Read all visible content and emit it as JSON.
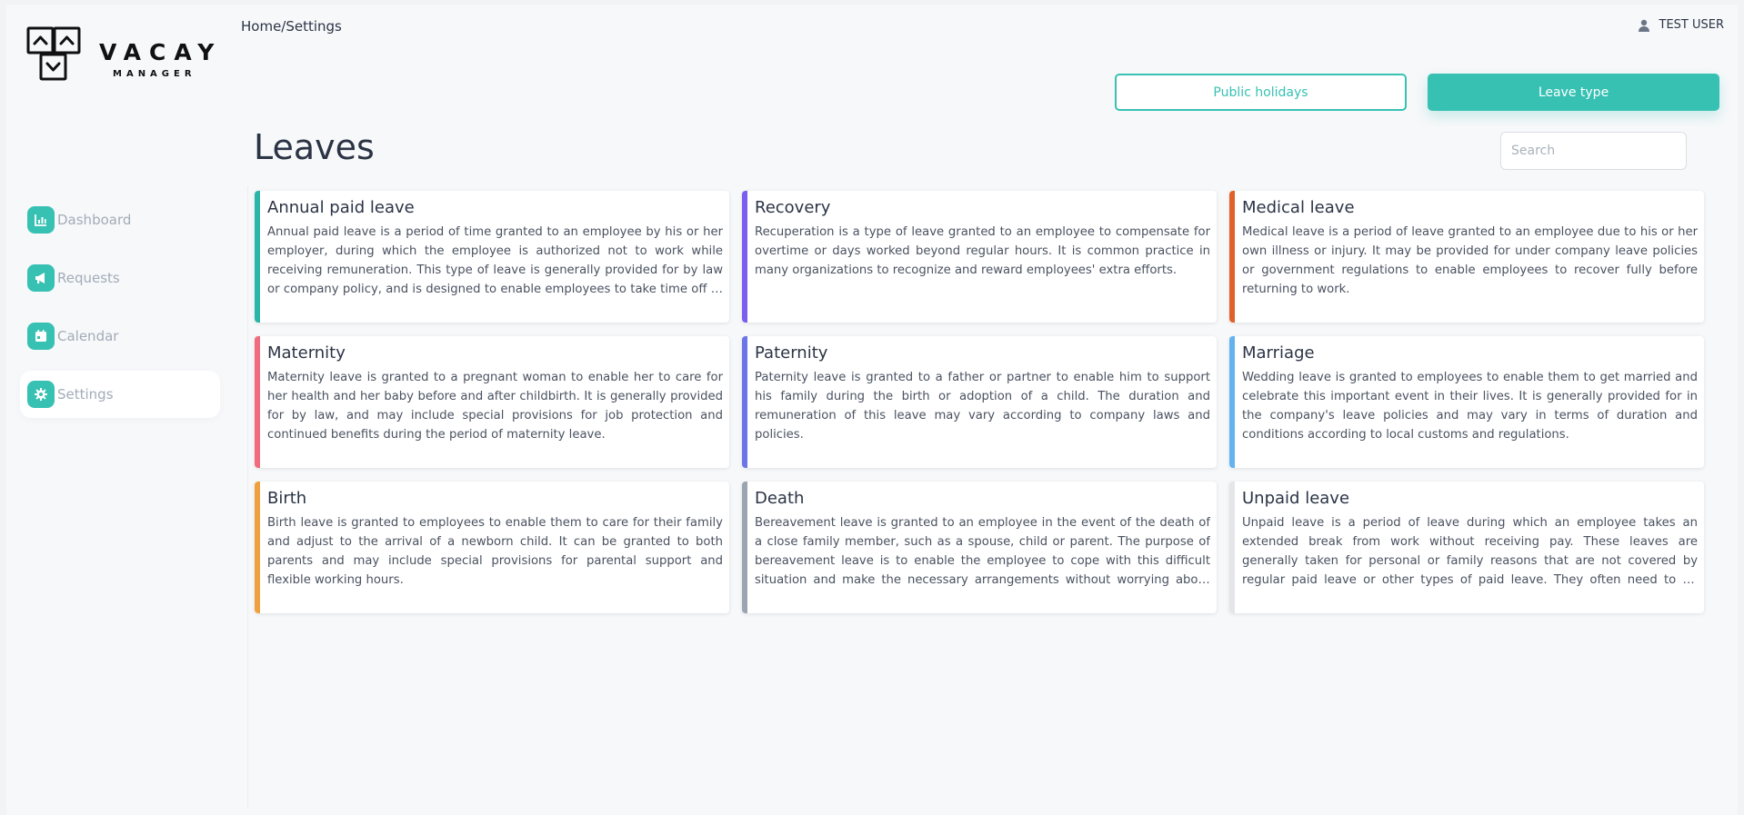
{
  "app": {
    "logo_word": "VACAY",
    "logo_sub": "MANAGER",
    "accent_color": "#37c1b3"
  },
  "header": {
    "breadcrumb": "Home/Settings",
    "user_name": "TEST USER",
    "user_icon": "user-icon"
  },
  "sidebar": {
    "items": [
      {
        "label": "Dashboard",
        "icon": "chart-icon",
        "active": false
      },
      {
        "label": "Requests",
        "icon": "megaphone-icon",
        "active": false
      },
      {
        "label": "Calendar",
        "icon": "calendar-icon",
        "active": false
      },
      {
        "label": "Settings",
        "icon": "gear-icon",
        "active": true
      }
    ]
  },
  "actions": {
    "public_holidays_label": "Public holidays",
    "leave_type_label": "Leave type"
  },
  "main": {
    "title": "Leaves",
    "search_placeholder": "Search"
  },
  "leaves": [
    {
      "title": "Annual paid leave",
      "color": "#2bb5a8",
      "description": "Annual paid leave is a period of time granted to an employee by his or her employer, during which the employee is authorized not to work while receiving remuneration. This type of leave is generally provided for by law or company policy, and is designed to enable employees to take time off to rest and recharge."
    },
    {
      "title": "Recovery",
      "color": "#7b5ef0",
      "description": "Recuperation is a type of leave granted to an employee to compensate for overtime or days worked beyond regular hours. It is common practice in many organizations to recognize and reward employees' extra efforts."
    },
    {
      "title": "Medical leave",
      "color": "#e0622a",
      "description": "Medical leave is a period of leave granted to an employee due to his or her own illness or injury. It may be provided for under company leave policies or government regulations to enable employees to recover fully before returning to work."
    },
    {
      "title": "Maternity",
      "color": "#ef6b7d",
      "description": "Maternity leave is granted to a pregnant woman to enable her to care for her health and her baby before and after childbirth. It is generally provided for by law, and may include special provisions for job protection and continued benefits during the period of maternity leave."
    },
    {
      "title": "Paternity",
      "color": "#6c74ea",
      "description": "Paternity leave is granted to a father or partner to enable him to support his family during the birth or adoption of a child. The duration and remuneration of this leave may vary according to company laws and policies."
    },
    {
      "title": "Marriage",
      "color": "#62b3f0",
      "description": "Wedding leave is granted to employees to enable them to get married and celebrate this important event in their lives. It is generally provided for in the company's leave policies and may vary in terms of duration and conditions according to local customs and regulations."
    },
    {
      "title": "Birth",
      "color": "#eea23f",
      "description": "Birth leave is granted to employees to enable them to care for their family and adjust to the arrival of a newborn child. It can be granted to both parents and may include special provisions for parental support and flexible working hours."
    },
    {
      "title": "Death",
      "color": "#9aa5b1",
      "description": "Bereavement leave is granted to an employee in the event of the death of a close family member, such as a spouse, child or parent. The purpose of bereavement leave is to enable the employee to cope with this difficult situation and make the necessary arrangements without worrying about work."
    },
    {
      "title": "Unpaid leave",
      "color": "#e4e6e9",
      "description": "Unpaid leave is a period of leave during which an employee takes an extended break from work without receiving pay. These leaves are generally taken for personal or family reasons that are not covered by regular paid leave or other types of paid leave. They often need to be approved by the employer."
    }
  ]
}
